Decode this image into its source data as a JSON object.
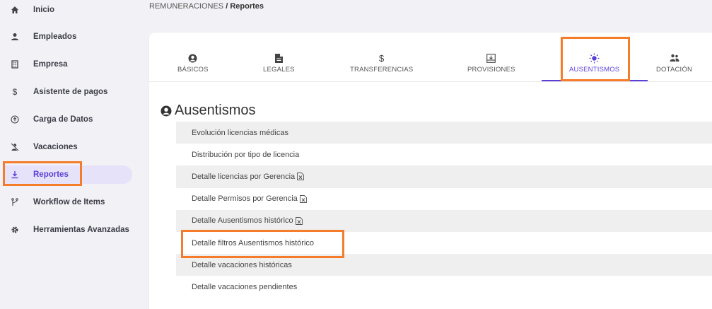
{
  "sidebar": {
    "items": [
      {
        "label": "Inicio",
        "icon": "home-icon"
      },
      {
        "label": "Empleados",
        "icon": "person-icon"
      },
      {
        "label": "Empresa",
        "icon": "building-icon"
      },
      {
        "label": "Asistente de pagos",
        "icon": "dollar-icon"
      },
      {
        "label": "Carga de Datos",
        "icon": "upload-circle-icon"
      },
      {
        "label": "Vacaciones",
        "icon": "person-off-icon"
      },
      {
        "label": "Reportes",
        "icon": "download-icon",
        "active": true
      },
      {
        "label": "Workflow de Items",
        "icon": "branch-icon"
      },
      {
        "label": "Herramientas Avanzadas",
        "icon": "gear-icon"
      }
    ]
  },
  "breadcrumb": {
    "parent": "REMUNERACIONES",
    "separator": "/",
    "current": "Reportes"
  },
  "tabs": [
    {
      "label": "BÁSICOS",
      "icon": "user-circle-icon"
    },
    {
      "label": "LEGALES",
      "icon": "file-icon"
    },
    {
      "label": "TRANSFERENCIAS",
      "icon": "dollar-icon"
    },
    {
      "label": "PROVISIONES",
      "icon": "archive-download-icon"
    },
    {
      "label": "AUSENTISMOS",
      "icon": "sun-icon",
      "active": true
    },
    {
      "label": "DOTACIÓN",
      "icon": "users-icon"
    }
  ],
  "section": {
    "title": "Ausentismos",
    "icon": "user-circle-icon"
  },
  "reports": [
    {
      "label": "Evolución licencias médicas",
      "excel": false
    },
    {
      "label": "Distribución por tipo de licencia",
      "excel": false
    },
    {
      "label": "Detalle licencias por Gerencia",
      "excel": true
    },
    {
      "label": "Detalle Permisos por Gerencia",
      "excel": true
    },
    {
      "label": "Detalle Ausentismos histórico",
      "excel": true
    },
    {
      "label": "Detalle filtros Ausentismos histórico",
      "excel": false
    },
    {
      "label": "Detalle vacaciones históricas",
      "excel": false
    },
    {
      "label": "Detalle vacaciones pendientes",
      "excel": false
    }
  ],
  "colors": {
    "accent": "#5b3fd6",
    "highlight": "#f47c2a",
    "sidebar_bg": "#f1f1f6",
    "active_bg": "#e6e2fa"
  }
}
